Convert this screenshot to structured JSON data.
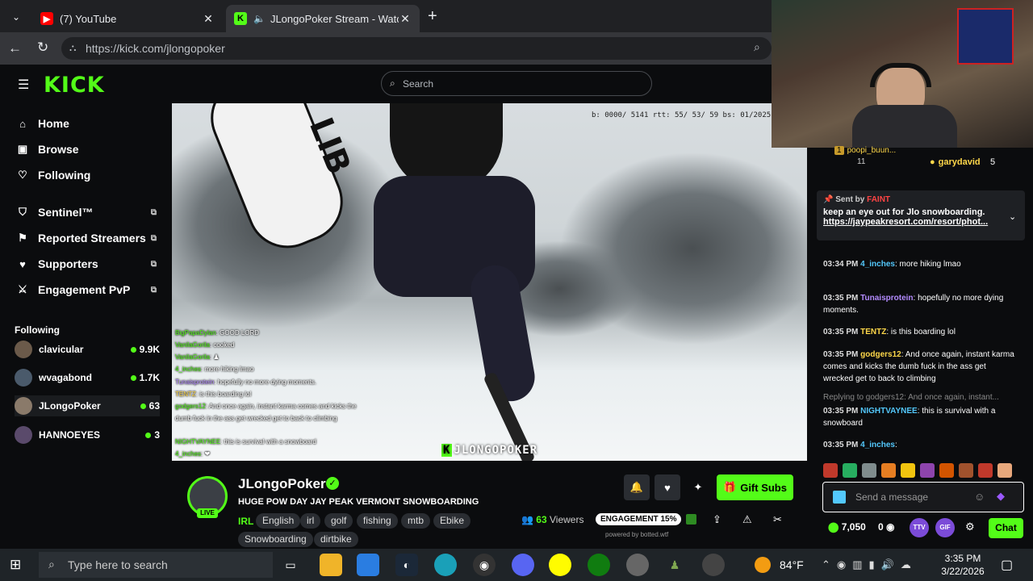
{
  "browser": {
    "tabs": [
      {
        "title": "(7) YouTube"
      },
      {
        "title": "JLongoPoker Stream - Watch Live on Kick"
      }
    ],
    "url": "https://kick.com/jlongopoker"
  },
  "kick": {
    "logo": "KICK",
    "search_placeholder": "Search",
    "nav": [
      {
        "label": "Home",
        "icon": "home-icon"
      },
      {
        "label": "Browse",
        "icon": "browse-icon"
      },
      {
        "label": "Following",
        "icon": "heart-icon"
      }
    ],
    "extensions": [
      {
        "label": "Sentinel™"
      },
      {
        "label": "Reported Streamers"
      },
      {
        "label": "Supporters"
      },
      {
        "label": "Engagement PvP"
      }
    ],
    "following_title": "Following",
    "following": [
      {
        "name": "clavicular",
        "count": "9.9K"
      },
      {
        "name": "wvagabond",
        "count": "1.7K"
      },
      {
        "name": "JLongoPoker",
        "count": "63"
      },
      {
        "name": "HANNOEYES",
        "count": "3"
      }
    ]
  },
  "video": {
    "stats": "b: 0000/ 5141 rtt: 55/ 53/ 59 bs: 01/2025",
    "watermark": "JLONGOPOKER",
    "overlay_chat": [
      {
        "user": "BigPapaDylan",
        "text": ": GOOD LORD"
      },
      {
        "user": "VanilaGorila",
        "text": ": cooked"
      },
      {
        "user": "VanilaGorila",
        "text": ": ♟"
      },
      {
        "user": "4_inches",
        "text": ": more hiking lmao"
      },
      {
        "user": "Tunaisprotein",
        "text": ": hopefully no more dying moments."
      },
      {
        "user": "TENTZ",
        "text": ": is this boarding lol"
      },
      {
        "user": "godgers12",
        "text": ": And once again, instant karma comes and kicks the dumb fuck in the ass get wrecked get to back to climbing"
      },
      {
        "user": "NIGHTVAYNEE",
        "text": ": this is survival with a snowboard"
      },
      {
        "user": "4_inches",
        "text": ": ❤"
      }
    ]
  },
  "channel": {
    "name": "JLongoPoker",
    "live": "LIVE",
    "title": "HUGE POW DAY JAY PEAK VERMONT SNOWBOARDING",
    "category": "IRL",
    "tags": [
      "English",
      "irl",
      "golf",
      "fishing",
      "mtb",
      "Ebike",
      "Snowboarding",
      "dirtbike"
    ],
    "viewers_count": "63",
    "viewers_label": "Viewers",
    "engagement": "ENGAGEMENT 15%",
    "powered": "powered by botted.wtf",
    "gift_subs": "Gift Subs"
  },
  "chat": {
    "top_user_1": "poopi_buun...",
    "top_user_1_count": "11",
    "top_user_2": "garydavid",
    "top_user_2_count": "5",
    "pinned_sender": "Sent by",
    "pinned_sender_name": "FAINT",
    "pinned_text": "keep an eye out for Jlo snowboarding.",
    "pinned_link": "https://jaypeakresort.com/resort/phot...",
    "messages": [
      {
        "time": "03:34 PM",
        "user": "4_inches",
        "user_color": "#53c8fc",
        "text": ": more hiking lmao"
      },
      {
        "time": "03:35 PM",
        "user": "Tunaisprotein",
        "user_color": "#b48cff",
        "text": ": hopefully no more dying moments."
      },
      {
        "time": "03:35 PM",
        "user": "TENTZ",
        "user_color": "#ffd84a",
        "text": ": is this boarding lol"
      },
      {
        "time": "03:35 PM",
        "user": "godgers12",
        "user_color": "#ffd84a",
        "text": ": And once again, instant karma comes and kicks the dumb fuck in the ass get wrecked get to back to climbing"
      },
      {
        "time": "03:35 PM",
        "user": "NIGHTVAYNEE",
        "user_color": "#53c8fc",
        "text": ": this is survival with a snowboard"
      },
      {
        "time": "03:35 PM",
        "user": "4_inches",
        "user_color": "#53c8fc",
        "text": ":"
      }
    ],
    "reply_text": "Replying to godgers12: And once again, instant...",
    "input_placeholder": "Send a message",
    "balance": "7,050",
    "points": "0",
    "badge_ttv": "TTV",
    "badge_gif": "GIF",
    "chat_button": "Chat"
  },
  "taskbar": {
    "search_placeholder": "Type here to search",
    "weather": "84°F",
    "time": "3:35 PM",
    "date": "3/22/2026"
  },
  "colors": {
    "kick_green": "#53fc18",
    "bg": "#0b0c0e"
  }
}
